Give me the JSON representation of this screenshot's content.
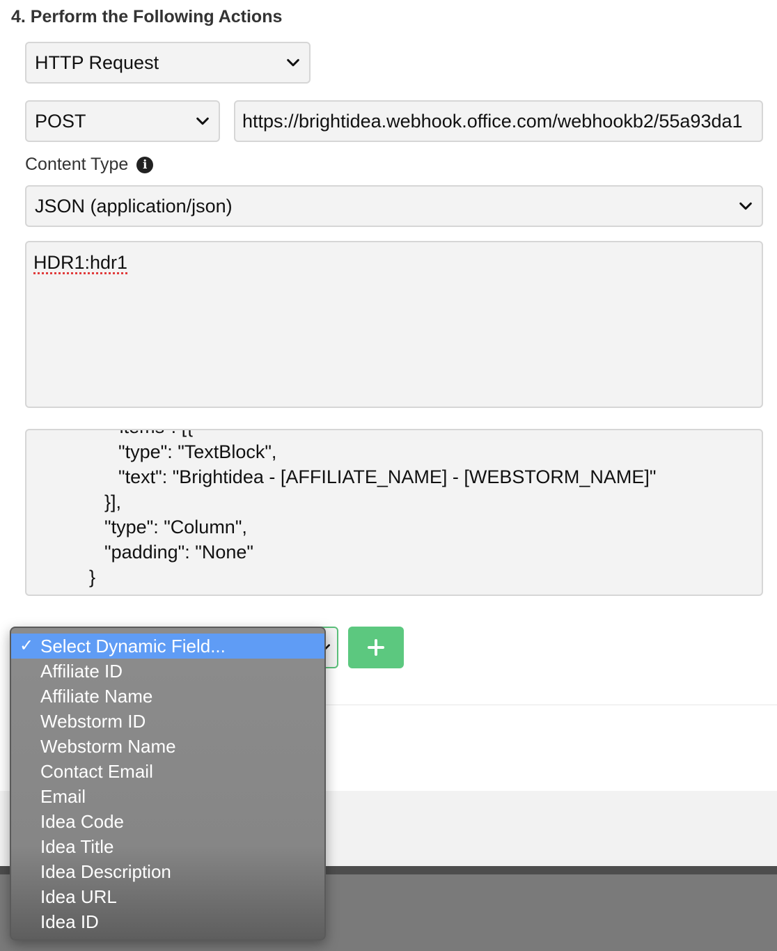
{
  "section": {
    "title": "4. Perform the Following Actions"
  },
  "action_select": {
    "value": "HTTP Request"
  },
  "method_select": {
    "value": "POST"
  },
  "url_input": {
    "value": "https://brightidea.webhook.office.com/webhookb2/55a93da1"
  },
  "content_type": {
    "label": "Content Type",
    "info_icon": "info-icon",
    "value": "JSON (application/json)"
  },
  "headers_textarea": {
    "value": "HDR1:hdr1"
  },
  "body_textarea": {
    "lines": [
      "\"items\": [{",
      "\"type\": \"TextBlock\",",
      "\"text\": \"Brightidea - [AFFILIATE_NAME] - [WEBSTORM_NAME]\"",
      "}],",
      "\"type\": \"Column\",",
      "\"padding\": \"None\"",
      "}"
    ]
  },
  "dynamic_field": {
    "check_mark": "✓",
    "options": [
      "Select Dynamic Field...",
      "Affiliate ID",
      "Affiliate Name",
      "Webstorm ID",
      "Webstorm Name",
      "Contact Email",
      "Email",
      "Idea Code",
      "Idea Title",
      "Idea Description",
      "Idea URL",
      "Idea ID"
    ],
    "add_button_icon": "plus-icon"
  },
  "colors": {
    "accent_green": "#5cc87f",
    "selected_blue": "#5f9cf5",
    "field_bg": "#f3f3f3"
  }
}
